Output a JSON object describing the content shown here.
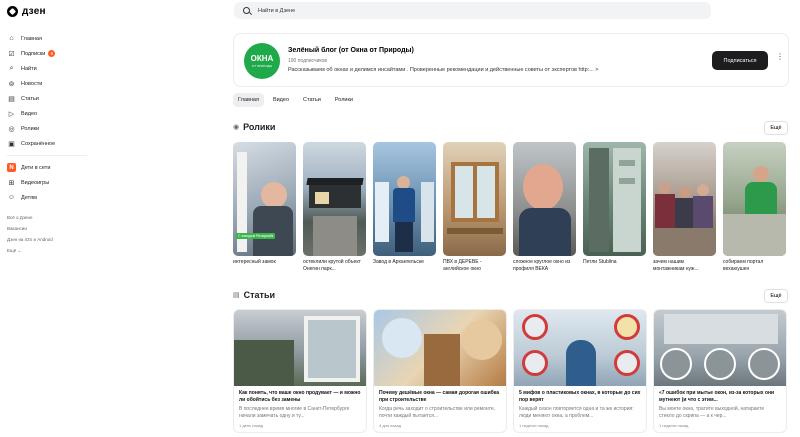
{
  "app": {
    "logo_text": "дзен"
  },
  "sidebar": {
    "items": [
      {
        "label": "Главная",
        "icon": "home-icon"
      },
      {
        "label": "Подписки",
        "icon": "subscriptions-icon",
        "badge": "6"
      },
      {
        "label": "Найти",
        "icon": "search-icon"
      },
      {
        "label": "Новости",
        "icon": "news-icon"
      },
      {
        "label": "Статьи",
        "icon": "articles-icon"
      },
      {
        "label": "Видео",
        "icon": "video-icon"
      },
      {
        "label": "Ролики",
        "icon": "shorts-icon"
      },
      {
        "label": "Сохранённое",
        "icon": "bookmark-icon"
      }
    ],
    "secondary": [
      {
        "label": "Дети в сети",
        "icon": "kids-icon"
      },
      {
        "label": "Видеоигры",
        "icon": "gamepad-icon"
      },
      {
        "label": "Детям",
        "icon": "kids-face-icon"
      }
    ],
    "links": [
      "Всё о Дзене",
      "Вакансии",
      "Дзен на iOS и Android",
      "Ещё ⌄"
    ]
  },
  "search": {
    "placeholder": "Найти в Дзене"
  },
  "channel": {
    "avatar_text": "ОКНА",
    "avatar_subtext": "ОТ ПРИРОДЫ",
    "title": "Зелёный блог (от Окна от Природы)",
    "subscribers": "190 подписчиков",
    "description": "Рассказываем об окнах и делимся инсайтами . Проверенные рекомендации и действенные советы от экспертов http:... >",
    "subscribe_label": "Подписаться",
    "more_label": "⋮"
  },
  "tabs": [
    {
      "label": "Главная",
      "active": true
    },
    {
      "label": "Видео",
      "active": false
    },
    {
      "label": "Статьи",
      "active": false
    },
    {
      "label": "Ролики",
      "active": false
    }
  ],
  "shorts_section": {
    "title": "Ролики",
    "all_label": "Ещё",
    "items": [
      {
        "label": "интересный замок",
        "overlay": "С заводом Рехаумайк",
        "bg": "#b7c3cf"
      },
      {
        "label": "остеклили крутой объект Онегин парк...",
        "overlay": "",
        "bg": "#7a8a99"
      },
      {
        "label": "Завод в Архангельске",
        "overlay": "",
        "bg": "#8fa9c2"
      },
      {
        "label": "ПВХ в ДЕРЕВЕ - английское окно",
        "overlay": "",
        "bg": "#c9b08a"
      },
      {
        "label": "сложное круглое окно из профиля ВЕКА",
        "overlay": "",
        "bg": "#9a8f83"
      },
      {
        "label": "Петли Stublina",
        "overlay": "",
        "bg": "#6f8c7d"
      },
      {
        "label": "зачем нашим монтажникам нуж...",
        "overlay": "",
        "bg": "#a69a91"
      },
      {
        "label": "собираем портал вехаюушен",
        "overlay": "",
        "bg": "#8fa08a"
      }
    ]
  },
  "articles_section": {
    "title": "Статьи",
    "all_label": "Ещё",
    "items": [
      {
        "title": "Как понять, что ваше окно продувает — и можно ли обойтись без замены",
        "desc": "В последнее время многие в Санкт-Петербурге начали замечать одну и ту...",
        "date": "1 день назад"
      },
      {
        "title": "Почему дешёвые окна — самая дорогая ошибка при строительстве",
        "desc": "Когда речь заходит о строительстве или ремонте, почти каждый пытается...",
        "date": "4 дня назад"
      },
      {
        "title": "5 мифов о пластиковых окнах, в которые до сих пор верят",
        "desc": "Каждый сезон повторяется одна и та же история: люди меняют окна, а проблем...",
        "date": "1 неделю назад"
      },
      {
        "title": "«7 ошибок при мытье окон, из-за которых они мутнеют (и что с этим...",
        "desc": "Вы моете окна, тратите выходной, натираете стекло до скрипа — а к чер...",
        "date": "1 неделю назад"
      }
    ]
  },
  "colors": {
    "accent": "#ff5a1f",
    "brand_green": "#1fa94a",
    "button_dark": "#1d1d1f"
  }
}
